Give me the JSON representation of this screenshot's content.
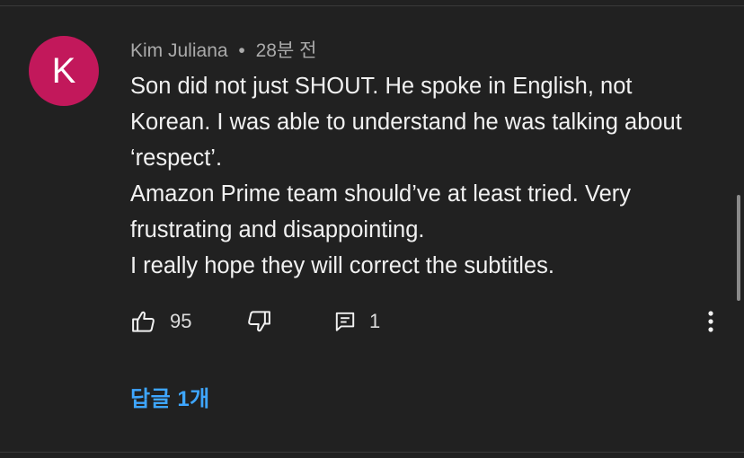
{
  "comment": {
    "avatar_letter": "K",
    "avatar_color": "#c2185b",
    "author": "Kim Juliana",
    "separator": "•",
    "time": "28분 전",
    "paragraphs": [
      "Son did not just SHOUT. He spoke in English, not Korean. I was able to understand he was talking about ‘respect’.",
      "Amazon Prime team should’ve at least tried. Very frustrating and disappointing.",
      "I really hope they will correct the subtitles."
    ]
  },
  "actions": {
    "like_icon": "thumbs-up-icon",
    "like_count": "95",
    "dislike_icon": "thumbs-down-icon",
    "reply_icon": "comment-icon",
    "reply_count": "1",
    "more_icon": "more-vertical-icon"
  },
  "replies": {
    "label": "답글 1개",
    "color": "#3ea6ff"
  }
}
